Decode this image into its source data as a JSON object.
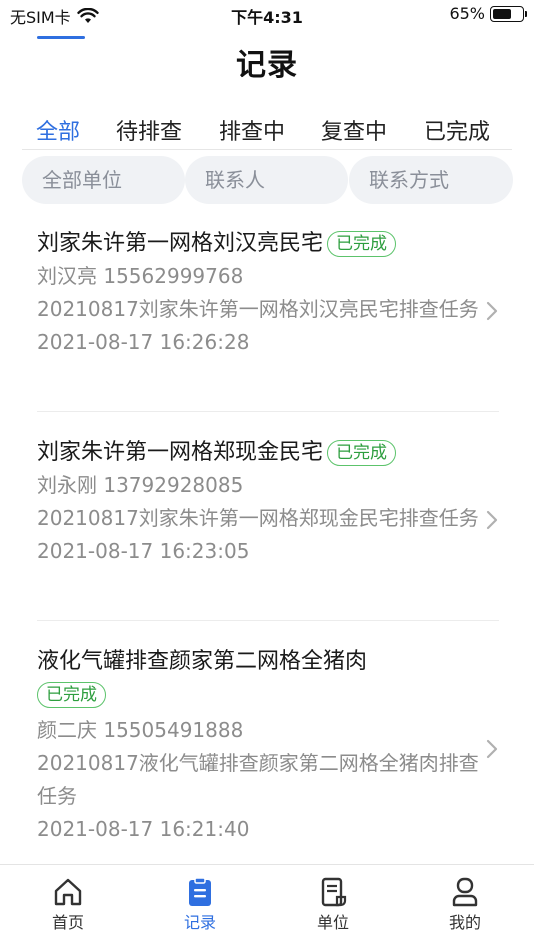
{
  "status_bar": {
    "carrier": "无SIM卡",
    "time": "下午4:31",
    "battery_text": "65%",
    "battery_level": 0.65
  },
  "header": {
    "title": "记录"
  },
  "tabs": [
    {
      "label": "全部",
      "active": true
    },
    {
      "label": "待排查",
      "active": false
    },
    {
      "label": "排查中",
      "active": false
    },
    {
      "label": "复查中",
      "active": false
    },
    {
      "label": "已完成",
      "active": false
    }
  ],
  "filters": {
    "unit_placeholder": "全部单位",
    "contact_placeholder": "联系人",
    "phone_placeholder": "联系方式"
  },
  "records": [
    {
      "title": "刘家朱许第一网格刘汉亮民宅",
      "status": "已完成",
      "contact": "刘汉亮 15562999768",
      "description": "20210817刘家朱许第一网格刘汉亮民宅排查任务",
      "time": "2021-08-17 16:26:28"
    },
    {
      "title": "刘家朱许第一网格郑现金民宅",
      "status": "已完成",
      "contact": "刘永刚 13792928085",
      "description": "20210817刘家朱许第一网格郑现金民宅排查任务",
      "time": "2021-08-17 16:23:05"
    },
    {
      "title": "液化气罐排查颜家第二网格全猪肉",
      "status": "已完成",
      "contact": "颜二庆 15505491888",
      "description": "20210817液化气罐排查颜家第二网格全猪肉排查任务",
      "time": "2021-08-17 16:21:40"
    }
  ],
  "tabbar": [
    {
      "label": "首页",
      "icon": "home-icon",
      "active": false
    },
    {
      "label": "记录",
      "icon": "clipboard-icon",
      "active": true
    },
    {
      "label": "单位",
      "icon": "document-icon",
      "active": false
    },
    {
      "label": "我的",
      "icon": "user-icon",
      "active": false
    }
  ],
  "colors": {
    "accent": "#2f6fe0",
    "success": "#2e9e3f"
  }
}
